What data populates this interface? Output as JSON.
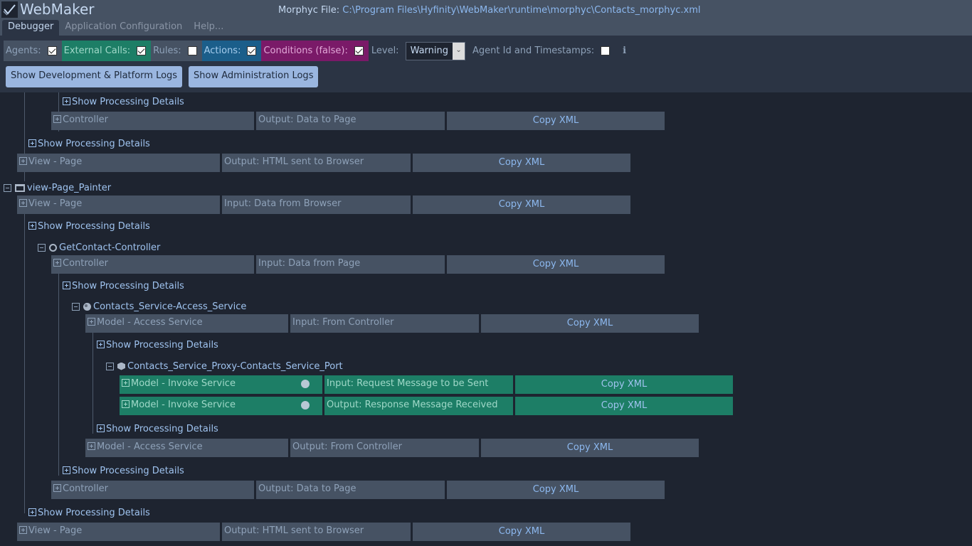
{
  "header": {
    "app_title": "WebMaker",
    "file_label": "Morphyc File:",
    "file_path": "C:\\Program Files\\Hyfinity\\WebMaker\\runtime\\morphyc\\Contacts_morphyc.xml",
    "tabs": [
      {
        "label": "Debugger",
        "active": true
      },
      {
        "label": "Application Configuration",
        "active": false
      },
      {
        "label": "Help...",
        "active": false
      }
    ]
  },
  "filters": {
    "agents": {
      "label": "Agents:",
      "checked": true
    },
    "external_calls": {
      "label": "External Calls:",
      "checked": true
    },
    "rules": {
      "label": "Rules:",
      "checked": false
    },
    "actions": {
      "label": "Actions:",
      "checked": true
    },
    "conditions": {
      "label": "Conditions (false):",
      "checked": true
    },
    "level": {
      "label": "Level:",
      "value": "Warning"
    },
    "agent_id": {
      "label": "Agent Id and Timestamps:",
      "checked": false
    },
    "info_icon": "info-icon"
  },
  "buttons": {
    "dev_logs": "Show Development & Platform Logs",
    "admin_logs": "Show Administration Logs"
  },
  "colors": {
    "external_calls": "#1d7e66",
    "actions": "#1b5e8a",
    "conditions": "#7a1a68",
    "row": "#465263",
    "background": "#1e2430"
  },
  "tree": {
    "show_details": "Show Processing Details",
    "copy_xml": "Copy XML",
    "rows": [
      {
        "name": "Controller",
        "io": "Output: Data to Page"
      },
      {
        "name": "View - Page",
        "io": "Output: HTML sent to Browser"
      },
      {
        "name": "View - Page",
        "io": "Input: Data from Browser"
      },
      {
        "name": "Controller",
        "io": "Input: Data from Page"
      },
      {
        "name": "Model - Access Service",
        "io": "Input: From Controller"
      },
      {
        "name": "Model - Invoke Service",
        "io": "Input: Request Message to be Sent"
      },
      {
        "name": "Model - Invoke Service",
        "io": "Output: Response Message Received"
      },
      {
        "name": "Model - Access Service",
        "io": "Output: From Controller"
      },
      {
        "name": "Controller",
        "io": "Output: Data to Page"
      },
      {
        "name": "View - Page",
        "io": "Output: HTML sent to Browser"
      }
    ],
    "nodes": {
      "page": "view-Page_Painter",
      "controller": "GetContact-Controller",
      "access_service": "Contacts_Service-Access_Service",
      "proxy": "Contacts_Service_Proxy-Contacts_Service_Port"
    }
  }
}
